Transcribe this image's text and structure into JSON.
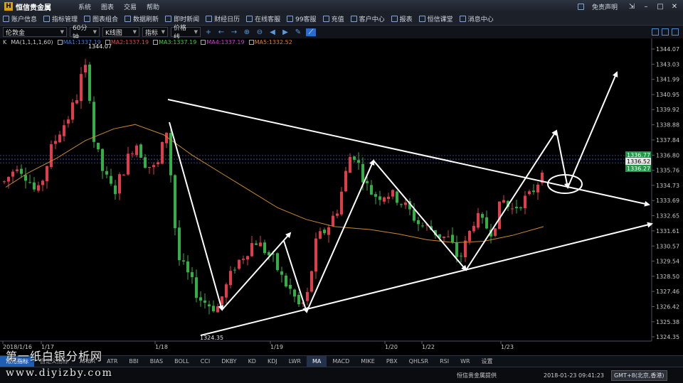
{
  "app": {
    "title": "恒信贵金属",
    "logo_glyph": "H",
    "menu": [
      "系统",
      "图表",
      "交易",
      "帮助"
    ],
    "disclaimer": "免责声明"
  },
  "toolbar1": [
    "账户信息",
    "指标管理",
    "图表组合",
    "数据刷新",
    "即时新闻",
    "财经日历",
    "在线客服",
    "99客服",
    "充值",
    "客户中心",
    "报表",
    "恒信课堂",
    "消息中心"
  ],
  "toolbar2": {
    "symbol": "伦敦金",
    "period": "60分钟",
    "chart_type": "K线图",
    "indicator": "指标",
    "price_line": "价格线"
  },
  "ma_legend": {
    "k_label": "K",
    "params": "MA(1,1,1,1,60)",
    "items": [
      {
        "label": "MA1:1337.19",
        "color": "#3b7fe0"
      },
      {
        "label": "MA2:1337.19",
        "color": "#e04848"
      },
      {
        "label": "MA3:1337.19",
        "color": "#48c848"
      },
      {
        "label": "MA4:1337.19",
        "color": "#d040d0"
      },
      {
        "label": "MA5:1332.52",
        "color": "#e08020"
      }
    ]
  },
  "chart_data": {
    "type": "candlestick",
    "y_ticks": [
      "1344.07",
      "1343.03",
      "1341.99",
      "1340.95",
      "1339.92",
      "1338.88",
      "1337.84",
      "1336.80",
      "1335.76",
      "1334.73",
      "1333.69",
      "1332.65",
      "1331.61",
      "1330.57",
      "1329.54",
      "1328.50",
      "1327.46",
      "1326.42",
      "1325.38",
      "1324.35"
    ],
    "ylim": [
      1324.35,
      1344.07
    ],
    "x_labels": [
      "2018/1/16",
      "1/17",
      "1/18",
      "1/19",
      "1/20",
      "1/22",
      "1/23"
    ],
    "high_label": "1344.07",
    "low_label": "1324.35",
    "price_tags": [
      {
        "label": "1336.77",
        "value": 1336.77,
        "color": "#1f9a4a"
      },
      {
        "label": "1336.52",
        "value": 1336.52,
        "color": "#e8e8e8"
      },
      {
        "label": "1336.27",
        "value": 1336.27,
        "color": "#1f9a4a"
      }
    ],
    "up_color": "#e03c4c",
    "down_color": "#33b045",
    "ma_color": "#c88a2c"
  },
  "bottom_tabs": [
    "常用指标",
    "自定义指标",
    "ARBR",
    "ATR",
    "BBI",
    "BIAS",
    "BOLL",
    "CCI",
    "DKBY",
    "KD",
    "KDJ",
    "LWR",
    "MA",
    "MACD",
    "MIKE",
    "PBX",
    "QHLSR",
    "RSI",
    "WR",
    "设置"
  ],
  "status": {
    "provider": "恒信贵金属提供",
    "time": "2018-01-23 09:41:23",
    "timezone": "GMT+8(北京,香港)"
  },
  "watermark": {
    "line1": "第一纸白银分析网",
    "line2": "www.diyizby.com"
  }
}
